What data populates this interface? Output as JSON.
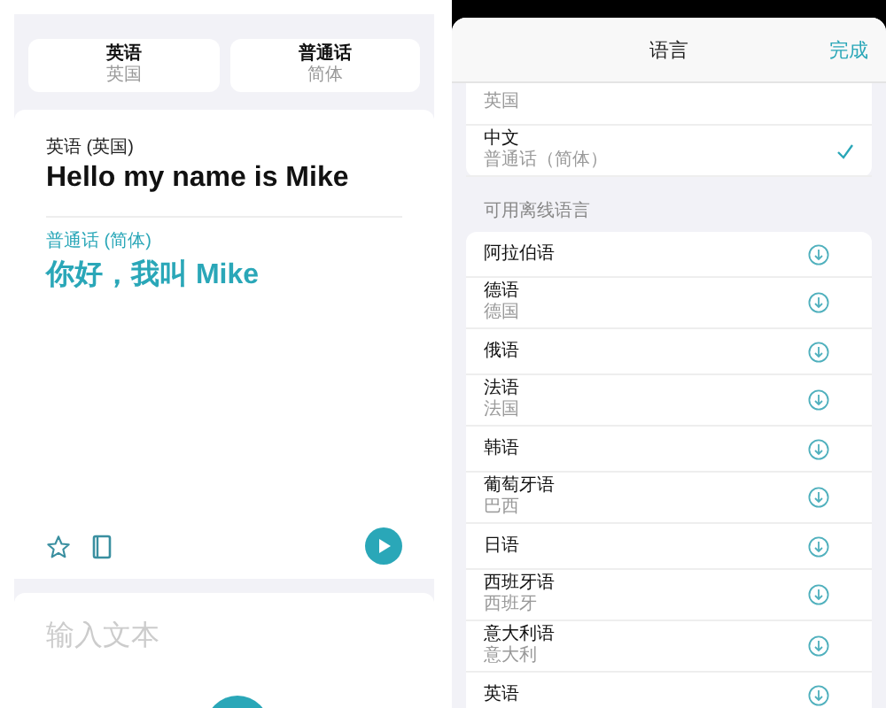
{
  "left": {
    "language_tabs": [
      {
        "label": "英语",
        "sublabel": "英国"
      },
      {
        "label": "普通话",
        "sublabel": "简体"
      }
    ],
    "translation": {
      "source_language": "英语 (英国)",
      "source_text": "Hello my name is Mike",
      "target_language": "普通话 (简体)",
      "target_text": "你好，我叫 Mike"
    },
    "input": {
      "placeholder": "输入文本"
    }
  },
  "right": {
    "header": {
      "title": "语言",
      "done": "完成"
    },
    "current_languages": [
      {
        "sublabel": "英国",
        "selected": false
      },
      {
        "name": "中文",
        "sublabel": "普通话（简体）",
        "selected": true
      }
    ],
    "section_title": "可用离线语言",
    "offline_languages": [
      {
        "name": "阿拉伯语"
      },
      {
        "name": "德语",
        "sublabel": "德国"
      },
      {
        "name": "俄语"
      },
      {
        "name": "法语",
        "sublabel": "法国"
      },
      {
        "name": "韩语"
      },
      {
        "name": "葡萄牙语",
        "sublabel": "巴西"
      },
      {
        "name": "日语"
      },
      {
        "name": "西班牙语",
        "sublabel": "西班牙"
      },
      {
        "name": "意大利语",
        "sublabel": "意大利"
      },
      {
        "name": "英语"
      }
    ]
  }
}
